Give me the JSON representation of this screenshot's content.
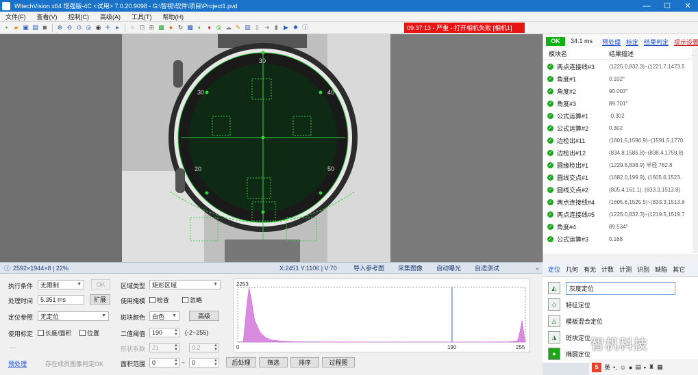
{
  "window": {
    "title": "WitechVision x64 增强版-4C <试用> 7.0.20.9098 - G:\\智视\\软件\\项目\\Project1.pvd",
    "controls": {
      "minimize": "—",
      "maximize": "☐",
      "close": "✕"
    }
  },
  "menu": {
    "items": [
      "文件(F)",
      "查看(V)",
      "控制(C)",
      "高级(A)",
      "工具(T)",
      "帮助(H)"
    ]
  },
  "alarm": {
    "text": "09:37:13 - 严重 - 打开相机失败 [相机1]",
    "color": "#e81414"
  },
  "statusbar": {
    "image_info": "2592×1944×8 | 22%",
    "coords": "X:2451  Y:1106 | V:70",
    "buttons": [
      "导入参考图",
      "采集图像",
      "自动曝光",
      "自适测试"
    ]
  },
  "props": {
    "exec_condition_label": "执行条件",
    "exec_condition_value": "无限制",
    "ok_button": "OK",
    "proc_time_label": "处理时间",
    "proc_time_value": "5.351 ms",
    "expand_button": "扩展",
    "position_ref_label": "定位参照",
    "position_ref_value": "无定位",
    "use_calib_label": "使用标定",
    "calib_length_area": "长度/面积",
    "calib_position": "位置",
    "unit_label": "---",
    "preprocess_link": "预处理",
    "save_hint": "存在成员图像判定OK",
    "region_type_label": "区域类型",
    "region_type_value": "矩形区域",
    "use_mask_label": "使用掩模",
    "check_label": "检查",
    "ignore_label": "忽略",
    "blob_color_label": "斑块颜色",
    "blob_color_value": "白色",
    "advanced_button": "高级",
    "threshold_label": "二值阈值",
    "threshold_value": "190",
    "threshold_range": "(-2~255)",
    "shape_scale_label": "形状系数",
    "shape_scale_value": "21",
    "shape_scale_value2": "0.2",
    "area_range_label": "面积范围",
    "area_min": "0",
    "area_tilde": "~",
    "area_max": "0",
    "postprocess_button": "后处理",
    "filter_button": "筛选",
    "sort_button": "排序",
    "process_chart_button": "过程图"
  },
  "histogram": {
    "max_label": "2253",
    "x_min_label": "0",
    "threshold_label": "190",
    "x_max_label": "255"
  },
  "chart_data": {
    "type": "area",
    "title": "",
    "xlabel": "",
    "ylabel": "",
    "xlim": [
      0,
      255
    ],
    "ylim": [
      0,
      2253
    ],
    "threshold": 190,
    "x": [
      0,
      5,
      8,
      10,
      12,
      15,
      20,
      25,
      30,
      40,
      60,
      100,
      150,
      200,
      240,
      248,
      250,
      252,
      254,
      255
    ],
    "values": [
      0,
      20,
      1500,
      2253,
      1800,
      900,
      400,
      180,
      90,
      40,
      15,
      8,
      6,
      6,
      10,
      60,
      400,
      900,
      250,
      0
    ]
  },
  "results": {
    "ok_label": "OK",
    "time": "34.1 ms",
    "links": [
      "预处理",
      "标定",
      "结果判定",
      "提示设置"
    ],
    "col_name": "模块名",
    "col_value": "结果描述",
    "rows": [
      {
        "name": "两点连接线#3",
        "value": "(1225.0,832.3)~(1221.7,1473.5"
      },
      {
        "name": "角度#1",
        "value": "0.102°"
      },
      {
        "name": "角度#2",
        "value": "90.003°"
      },
      {
        "name": "角度#3",
        "value": "89.701°"
      },
      {
        "name": "公式运算#1",
        "value": "-0.302"
      },
      {
        "name": "公式运算#2",
        "value": "0.302"
      },
      {
        "name": "边检出#11",
        "value": "(1601.5,1596.9)~(1591.5,1770."
      },
      {
        "name": "边检出#12",
        "value": "(834.8,1585.8)~(838.4,1759.8)"
      },
      {
        "name": "圆缘检出#1",
        "value": "(1229.8,838.9) 半径:782.8"
      },
      {
        "name": "圆线交点#1",
        "value": "(1682.0,199.9), (1605.6,1523."
      },
      {
        "name": "圆线交点#2",
        "value": "(805.4,161.1), (833.3,1513.8)"
      },
      {
        "name": "两点连接线#4",
        "value": "(1605.6,1525.5)~(833.3,1513.8"
      },
      {
        "name": "两点连接线#5",
        "value": "(1225.0,832.3)~(1219.5,1519.7"
      },
      {
        "name": "角度#4",
        "value": "89.534°"
      },
      {
        "name": "公式运算#3",
        "value": "0.168"
      }
    ]
  },
  "tool_tabs": [
    "定位",
    "几何",
    "有无",
    "计数",
    "计测",
    "识别",
    "缺陷",
    "其它"
  ],
  "tools": [
    {
      "label": "灰度定位"
    },
    {
      "label": "特征定位"
    },
    {
      "label": "模板混合定位"
    },
    {
      "label": "斑块定位"
    },
    {
      "label": "椭圆定位"
    }
  ],
  "watermark": "智机科技",
  "taskbar": {
    "ime": "S",
    "lang": "英"
  }
}
